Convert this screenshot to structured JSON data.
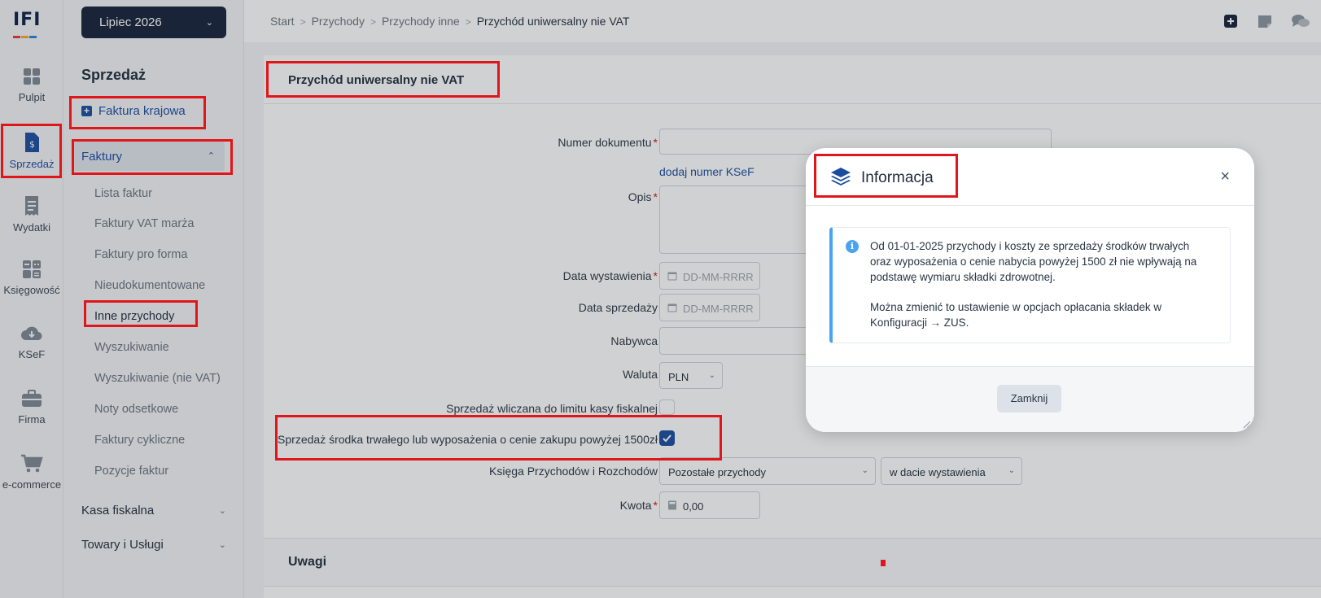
{
  "logo": {
    "text": "IFI"
  },
  "rail": [
    {
      "label": "Pulpit",
      "icon": "dashboard-icon"
    },
    {
      "label": "Sprzedaż",
      "icon": "invoice-dollar-icon"
    },
    {
      "label": "Wydatki",
      "icon": "receipt-icon"
    },
    {
      "label": "Księgowość",
      "icon": "calculator-icon"
    },
    {
      "label": "KSeF",
      "icon": "cloud-download-icon"
    },
    {
      "label": "Firma",
      "icon": "briefcase-icon"
    },
    {
      "label": "e-commerce",
      "icon": "cart-icon"
    }
  ],
  "period": {
    "label": "Lipiec 2026"
  },
  "subnav": {
    "title": "Sprzedaż",
    "new_invoice": "Faktura krajowa",
    "group_open": "Faktury",
    "items": [
      "Lista faktur",
      "Faktury VAT marża",
      "Faktury pro forma",
      "Nieudokumentowane",
      "Inne przychody",
      "Wyszukiwanie",
      "Wyszukiwanie (nie VAT)",
      "Noty odsetkowe",
      "Faktury cykliczne",
      "Pozycje faktur"
    ],
    "groups_closed": [
      "Kasa fiskalna",
      "Towary i Usługi"
    ]
  },
  "breadcrumbs": [
    "Start",
    "Przychody",
    "Przychody inne",
    "Przychód uniwersalny nie VAT"
  ],
  "top_icons": [
    "plus-square-icon",
    "note-icon",
    "chat-icon"
  ],
  "form": {
    "title": "Przychód uniwersalny nie VAT",
    "doc_number_label": "Numer dokumentu",
    "ksef_link": "dodaj numer KSeF",
    "description_label": "Opis",
    "issue_date_label": "Data wystawienia",
    "sale_date_label": "Data sprzedaży",
    "date_placeholder": "DD-MM-RRRR",
    "buyer_label": "Nabywca",
    "currency_label": "Waluta",
    "currency_value": "PLN",
    "fiscal_limit_label": "Sprzedaż wliczana do limitu kasy fiskalnej",
    "fixed_asset_label": "Sprzedaż środka trwałego lub wyposażenia o cenie zakupu powyżej 1500zł",
    "ledger_label": "Księga Przychodów i Rozchodów",
    "ledger_value": "Pozostałe przychody",
    "ledger_date_value": "w dacie wystawienia",
    "amount_label": "Kwota",
    "amount_value": "0,00",
    "remarks_title": "Uwagi"
  },
  "modal": {
    "title": "Informacja",
    "line1a": "Od 01-01-2025 przychody i koszty ze sprzedaży środków trwałych",
    "line1b": "oraz wyposażenia o cenie nabycia powyżej 1500 zł nie wpływają na",
    "line1c": "podstawę wymiaru składki zdrowotnej.",
    "line2a": "Można zmienić to ustawienie w opcjach opłacania składek w",
    "line2b": "Konfiguracji → ZUS.",
    "button": "Zamknij"
  },
  "colors": {
    "accent": "#1a4da1",
    "highlight": "#e0161b",
    "info": "#4aa3ef",
    "period_bg": "#17223b"
  }
}
